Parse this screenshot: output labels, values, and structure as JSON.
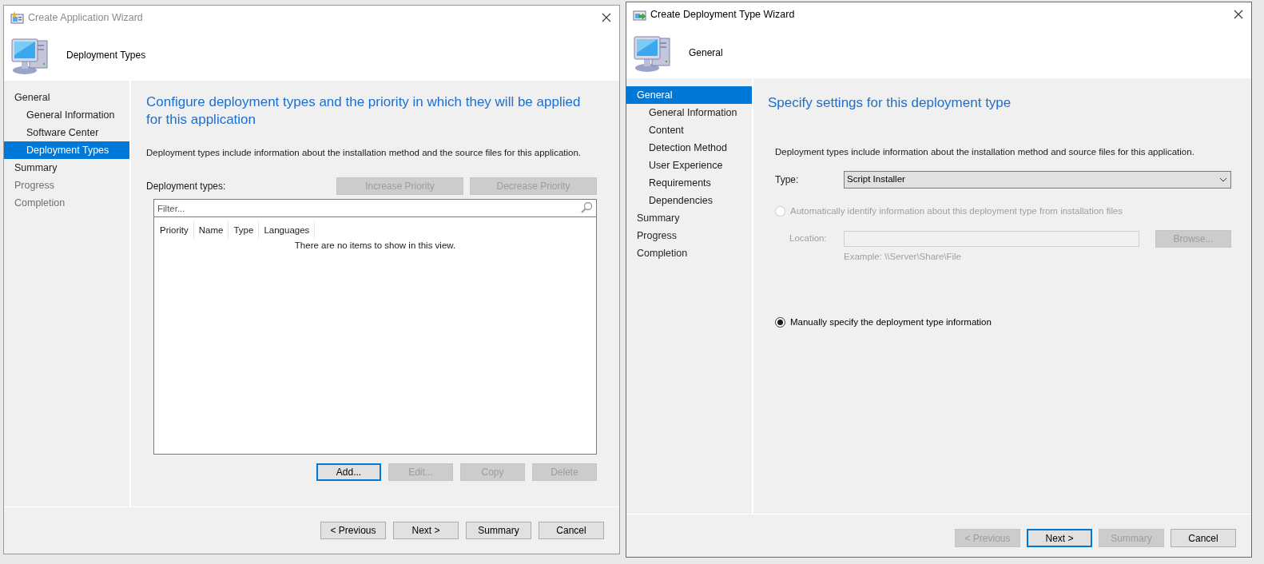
{
  "application_wizard": {
    "title": "Create Application Wizard",
    "active": false,
    "header_title": "Deployment Types",
    "nav": [
      {
        "label": "General",
        "selected": false,
        "disabled": false,
        "children": [
          {
            "label": "General Information",
            "selected": false,
            "disabled": false
          },
          {
            "label": "Software Center",
            "selected": false,
            "disabled": false
          },
          {
            "label": "Deployment Types",
            "selected": true,
            "disabled": false
          }
        ]
      },
      {
        "label": "Summary",
        "selected": false,
        "disabled": false
      },
      {
        "label": "Progress",
        "selected": false,
        "disabled": true
      },
      {
        "label": "Completion",
        "selected": false,
        "disabled": true
      }
    ],
    "heading": "Configure deployment types and the priority in which they will be applied for this application",
    "description": "Deployment types include information about the installation method and the source files for this application.",
    "list_label": "Deployment types:",
    "priority_buttons": [
      {
        "label": "Increase Priority",
        "disabled": true,
        "focused": false
      },
      {
        "label": "Decrease Priority",
        "disabled": true,
        "focused": false
      }
    ],
    "filter": {
      "placeholder": "Filter..."
    },
    "columns": [
      "Priority",
      "Name",
      "Type",
      "Languages"
    ],
    "empty_message": "There are no items to show in this view.",
    "action_buttons": [
      {
        "label": "Add...",
        "disabled": false,
        "focused": true
      },
      {
        "label": "Edit...",
        "disabled": true,
        "focused": false
      },
      {
        "label": "Copy",
        "disabled": true,
        "focused": false
      },
      {
        "label": "Delete",
        "disabled": true,
        "focused": false
      }
    ],
    "footer_buttons": [
      {
        "label": "< Previous",
        "disabled": false,
        "focused": false
      },
      {
        "label": "Next >",
        "disabled": false,
        "focused": false
      },
      {
        "label": "Summary",
        "disabled": false,
        "focused": false
      },
      {
        "label": "Cancel",
        "disabled": false,
        "focused": false
      }
    ]
  },
  "deployment_type_wizard": {
    "title": "Create Deployment Type Wizard",
    "active": true,
    "header_title": "General",
    "nav": [
      {
        "label": "General",
        "selected": true,
        "disabled": false,
        "children": [
          {
            "label": "General Information",
            "selected": false,
            "disabled": false
          },
          {
            "label": "Content",
            "selected": false,
            "disabled": false
          },
          {
            "label": "Detection Method",
            "selected": false,
            "disabled": false
          },
          {
            "label": "User Experience",
            "selected": false,
            "disabled": false
          },
          {
            "label": "Requirements",
            "selected": false,
            "disabled": false
          },
          {
            "label": "Dependencies",
            "selected": false,
            "disabled": false
          }
        ]
      },
      {
        "label": "Summary",
        "selected": false,
        "disabled": false
      },
      {
        "label": "Progress",
        "selected": false,
        "disabled": false
      },
      {
        "label": "Completion",
        "selected": false,
        "disabled": false
      }
    ],
    "heading": "Specify settings for this deployment type",
    "description": "Deployment types include information about the installation method and source files for this application.",
    "type_label": "Type:",
    "type_value": "Script Installer",
    "auto_option": {
      "label": "Automatically identify information about this deployment type from installation files",
      "selected": false,
      "disabled": true
    },
    "location_label": "Location:",
    "location_disabled": true,
    "location_example": "Example: \\\\Server\\Share\\File",
    "browse_button": {
      "label": "Browse...",
      "disabled": true,
      "focused": false
    },
    "manual_option": {
      "label": "Manually specify the deployment type information",
      "selected": true,
      "disabled": false
    },
    "footer_buttons": [
      {
        "label": "< Previous",
        "disabled": true,
        "focused": false
      },
      {
        "label": "Next >",
        "disabled": false,
        "focused": true
      },
      {
        "label": "Summary",
        "disabled": true,
        "focused": false
      },
      {
        "label": "Cancel",
        "disabled": false,
        "focused": false
      }
    ]
  }
}
